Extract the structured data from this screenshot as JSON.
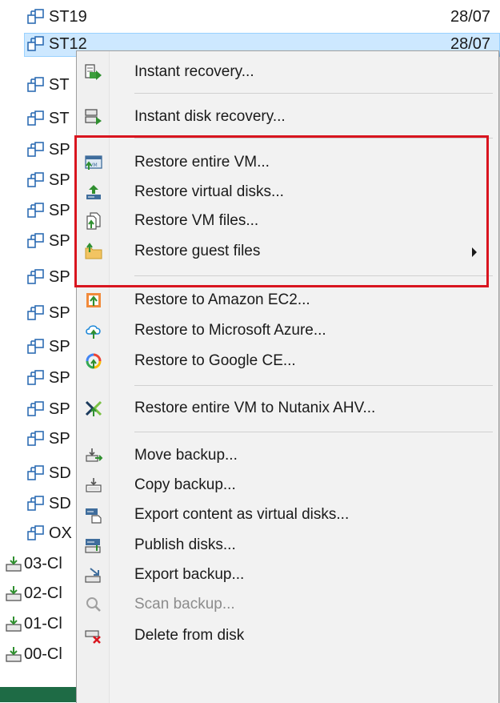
{
  "tree": {
    "rows": [
      {
        "label": "ST19",
        "date": "28/07"
      },
      {
        "label": "ST12",
        "date": "28/07"
      },
      {
        "label": "ST"
      },
      {
        "label": "ST"
      },
      {
        "label": "SP"
      },
      {
        "label": "SP"
      },
      {
        "label": "SP"
      },
      {
        "label": "SP"
      },
      {
        "label": "SP"
      },
      {
        "label": "SP"
      },
      {
        "label": "SP"
      },
      {
        "label": "SP"
      },
      {
        "label": "SP"
      },
      {
        "label": "SP"
      },
      {
        "label": "SD"
      },
      {
        "label": "SD"
      },
      {
        "label": "OX"
      },
      {
        "label": "03-Cl"
      },
      {
        "label": "02-Cl"
      },
      {
        "label": "01-Cl"
      },
      {
        "label": "00-Cl"
      }
    ]
  },
  "menu": {
    "items": [
      {
        "label": "Instant recovery...",
        "icon": "instant-recovery-icon"
      },
      {
        "label": "Instant disk recovery...",
        "icon": "instant-disk-recovery-icon"
      },
      {
        "label": "Restore entire VM...",
        "icon": "restore-vm-icon"
      },
      {
        "label": "Restore virtual disks...",
        "icon": "restore-disks-icon"
      },
      {
        "label": "Restore VM files...",
        "icon": "restore-files-icon"
      },
      {
        "label": "Restore guest files",
        "icon": "restore-guest-files-icon",
        "submenu": true
      },
      {
        "label": "Restore to Amazon EC2...",
        "icon": "amazon-ec2-icon"
      },
      {
        "label": "Restore to Microsoft Azure...",
        "icon": "azure-icon"
      },
      {
        "label": "Restore to Google CE...",
        "icon": "google-ce-icon"
      },
      {
        "label": "Restore entire VM to Nutanix AHV...",
        "icon": "nutanix-icon"
      },
      {
        "label": "Move backup...",
        "icon": "move-backup-icon"
      },
      {
        "label": "Copy backup...",
        "icon": "copy-backup-icon"
      },
      {
        "label": "Export content as virtual disks...",
        "icon": "export-content-icon"
      },
      {
        "label": "Publish disks...",
        "icon": "publish-disks-icon"
      },
      {
        "label": "Export backup...",
        "icon": "export-backup-icon"
      },
      {
        "label": "Scan backup...",
        "icon": "scan-backup-icon",
        "disabled": true
      },
      {
        "label": "Delete from disk",
        "icon": "delete-from-disk-icon"
      }
    ]
  },
  "colors": {
    "highlight_border": "#d9151f",
    "selection": "#cde8ff",
    "menu_bg": "#f2f2f2"
  }
}
